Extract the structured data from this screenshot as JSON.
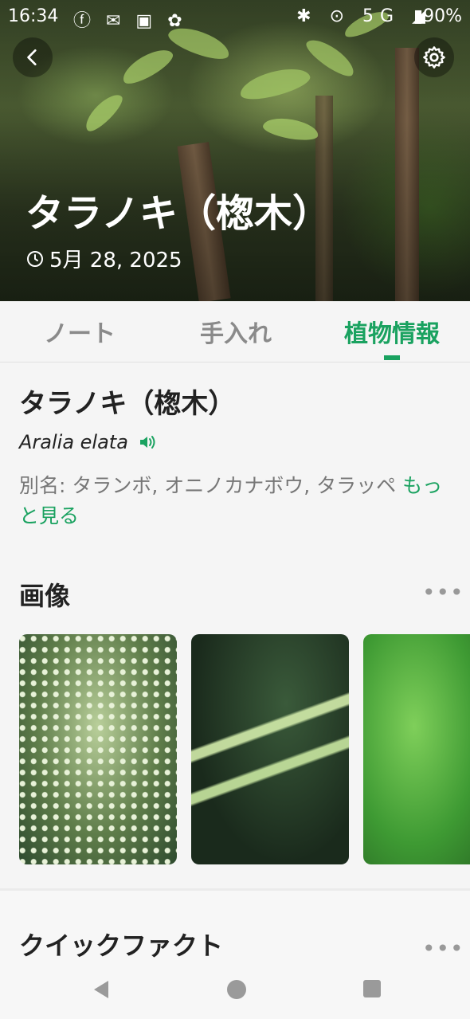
{
  "status_bar": {
    "time": "16:34",
    "network": "5G",
    "battery": "90%"
  },
  "hero": {
    "title": "タラノキ（楤木）",
    "date": "5月 28, 2025"
  },
  "tabs": [
    {
      "label": "ノート",
      "active": false
    },
    {
      "label": "手入れ",
      "active": false
    },
    {
      "label": "植物情報",
      "active": true
    }
  ],
  "plant": {
    "name": "タラノキ（楤木）",
    "scientific_name": "Aralia elata",
    "aliases_text": "別名: タランボ, オニノカナボウ, タラッペ",
    "more_label": "もっと見る"
  },
  "images_section": {
    "title": "画像",
    "more": "•••"
  },
  "quickfacts_section": {
    "title": "クイックファクト",
    "more": "•••"
  },
  "colors": {
    "accent": "#1aa260",
    "text": "#222222",
    "muted": "#8a8a8a"
  }
}
